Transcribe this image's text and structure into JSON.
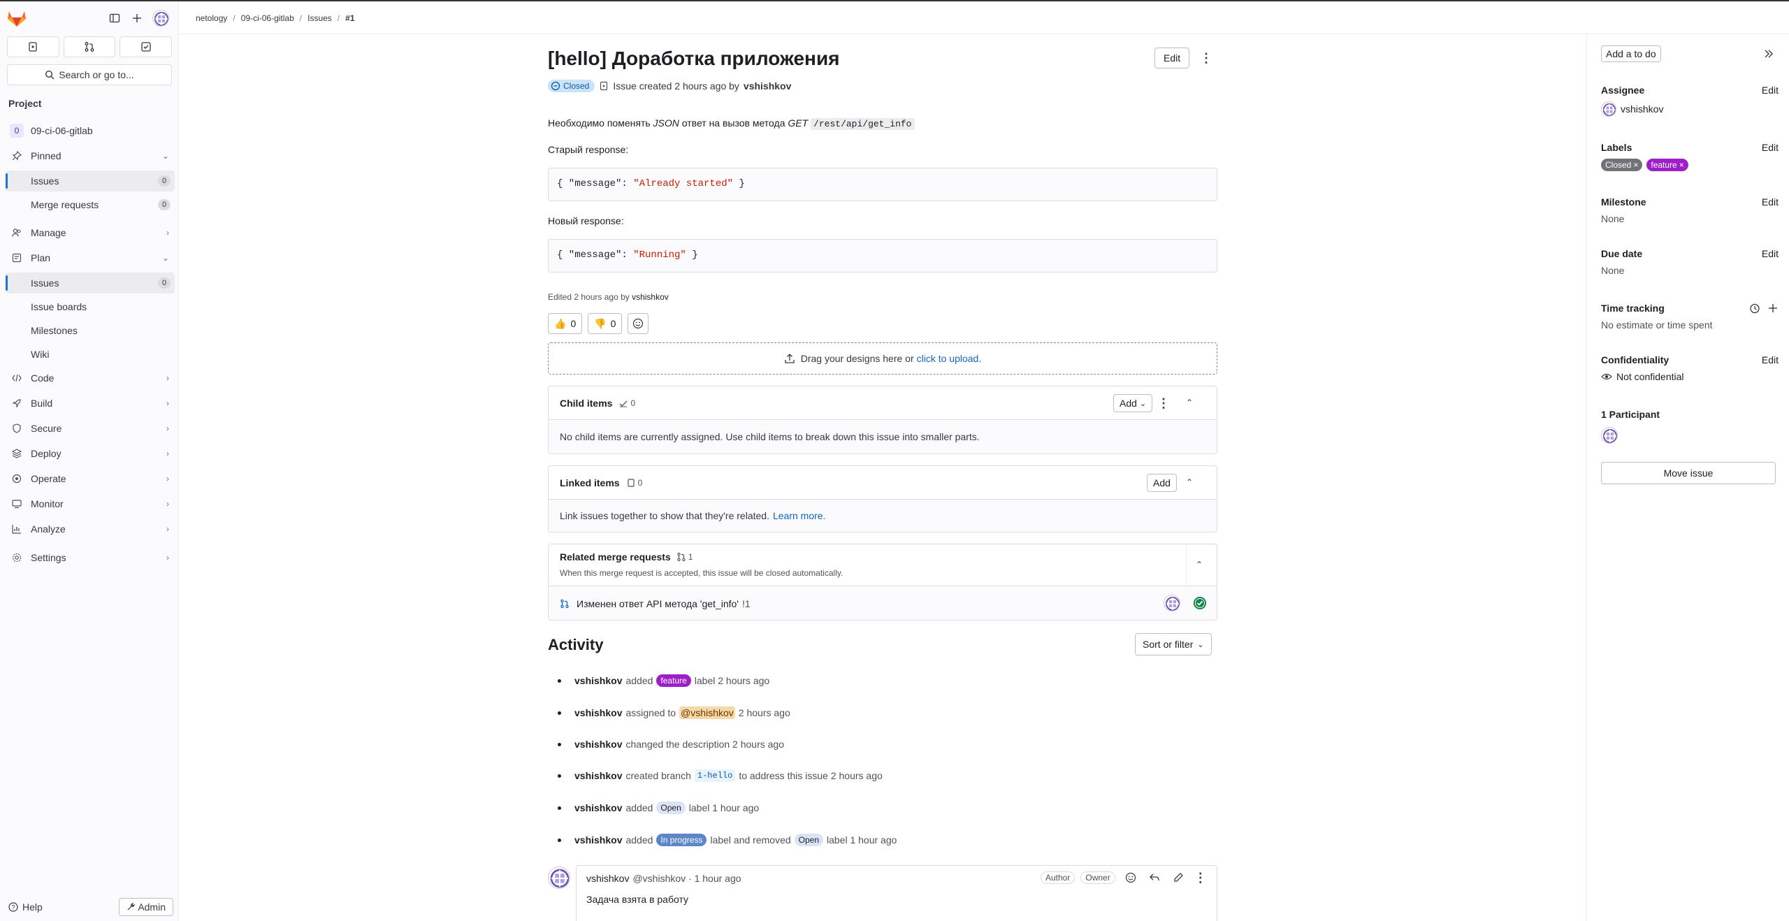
{
  "sidebar": {
    "counts": [
      "issues-count-icon",
      "merge-requests-count-icon",
      "todos-count-icon"
    ],
    "search_label": "Search or go to...",
    "section_heading": "Project",
    "project": {
      "initial": "0",
      "name": "09-ci-06-gitlab"
    },
    "pinned_label": "Pinned",
    "pinned_items": [
      {
        "label": "Issues",
        "count": "0"
      },
      {
        "label": "Merge requests",
        "count": "0"
      }
    ],
    "manage_label": "Manage",
    "plan_label": "Plan",
    "plan_items": [
      {
        "label": "Issues",
        "count": "0"
      },
      {
        "label": "Issue boards"
      },
      {
        "label": "Milestones"
      },
      {
        "label": "Wiki"
      }
    ],
    "groups": [
      "Code",
      "Build",
      "Secure",
      "Deploy",
      "Operate",
      "Monitor",
      "Analyze"
    ],
    "settings_label": "Settings",
    "help_label": "Help",
    "admin_label": "Admin"
  },
  "breadcrumb": [
    "netology",
    "09-ci-06-gitlab",
    "Issues",
    "#1"
  ],
  "issue": {
    "title": "[hello] Доработка приложения",
    "edit_label": "Edit",
    "status": "Closed",
    "created_text": "Issue created 2 hours ago by",
    "author": "vshishkov",
    "desc_prefix": "Необходимо поменять",
    "desc_json": "JSON",
    "desc_mid": "ответ на вызов метода",
    "desc_get": "GET",
    "desc_endpoint": "/rest/api/get_info",
    "old_label": "Старый response:",
    "old_code_pre": "{ \"message\": ",
    "old_code_str": "\"Already started\"",
    "old_code_post": " }",
    "new_label": "Новый response:",
    "new_code_pre": "{ \"message\": ",
    "new_code_str": "\"Running\"",
    "new_code_post": " }",
    "edited_text": "Edited 2 hours ago by",
    "edited_by": "vshishkov",
    "thumbs_up": "0",
    "thumbs_down": "0",
    "drop_text": "Drag your designs here or",
    "drop_link": "click to upload",
    "drop_end": "."
  },
  "child_items": {
    "title": "Child items",
    "count": "0",
    "add_label": "Add",
    "empty": "No child items are currently assigned. Use child items to break down this issue into smaller parts."
  },
  "linked_items": {
    "title": "Linked items",
    "count": "0",
    "add_label": "Add",
    "empty": "Link issues together to show that they're related.",
    "learn_more": "Learn more."
  },
  "related_mrs": {
    "title": "Related merge requests",
    "count": "1",
    "subtitle": "When this merge request is accepted, this issue will be closed automatically.",
    "mr_title": "Изменен ответ API метода 'get_info'",
    "mr_ref": "!1"
  },
  "activity": {
    "title": "Activity",
    "sort_label": "Sort or filter",
    "items": [
      {
        "who": "vshishkov",
        "a": "added",
        "label": "feature",
        "b": "label 2 hours ago"
      },
      {
        "who": "vshishkov",
        "a": "assigned to",
        "mention": "@vshishkov",
        "b": "2 hours ago"
      },
      {
        "who": "vshishkov",
        "a": "changed the description 2 hours ago"
      },
      {
        "who": "vshishkov",
        "a": "created branch",
        "code": "1-hello",
        "b": "to address this issue 2 hours ago"
      },
      {
        "who": "vshishkov",
        "a": "added",
        "label": "Open",
        "b": "label 1 hour ago"
      },
      {
        "who": "vshishkov",
        "a": "added",
        "label": "In progress",
        "b": "label and removed",
        "label2": "Open",
        "c": "label 1 hour ago"
      }
    ],
    "comment": {
      "author": "vshishkov",
      "handle": "@vshishkov · 1 hour ago",
      "role1": "Author",
      "role2": "Owner",
      "text": "Задача взята в работу"
    }
  },
  "right_sidebar": {
    "todo_label": "Add a to do",
    "assignee_title": "Assignee",
    "assignee": "vshishkov",
    "labels_title": "Labels",
    "labels": [
      {
        "text": "Closed",
        "color": "#737278"
      },
      {
        "text": "feature",
        "color": "#9e1ec9"
      }
    ],
    "milestone_title": "Milestone",
    "milestone": "None",
    "due_title": "Due date",
    "due": "None",
    "time_title": "Time tracking",
    "time_value": "No estimate or time spent",
    "conf_title": "Confidentiality",
    "conf_value": "Not confidential",
    "participants_title": "1 Participant",
    "edit_label": "Edit",
    "move_label": "Move issue"
  },
  "colors": {
    "feature": "#9e1ec9",
    "open": "#dbe4f5",
    "in_progress": "#5c86c8",
    "link": "#1068bf",
    "closed_badge": "#cbe2f9"
  }
}
